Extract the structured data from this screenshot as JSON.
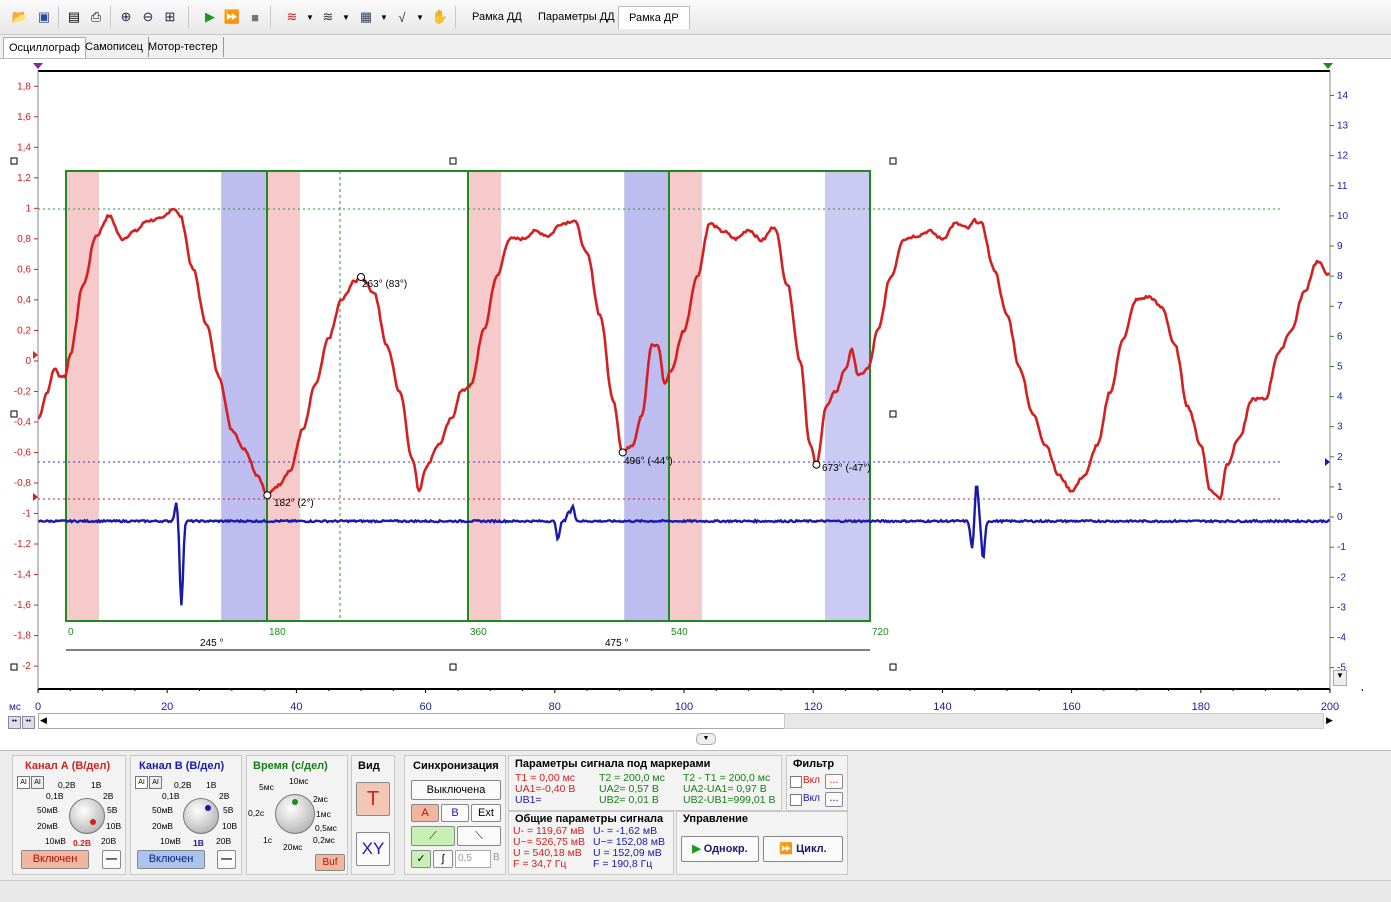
{
  "colors": {
    "channel_a": "#d42020",
    "channel_b": "#1a1aa8",
    "frame": "#1f8a1f",
    "zone_red": "#f3b8b8",
    "zone_blue": "#b8b8ee"
  },
  "toolbar": {
    "icons": [
      "open-icon",
      "save-icon",
      "print-preview-icon",
      "print-icon",
      "zoom-in-icon",
      "zoom-out-icon",
      "zoom-fit-icon",
      "start-icon",
      "fast-start-icon",
      "stop-icon",
      "signal-tool-icon",
      "signal-tool-2-icon",
      "calculator-icon",
      "math-function-icon",
      "settings-icon"
    ],
    "tabs": [
      "Рамка ДД",
      "Параметры ДД",
      "Рамка ДР"
    ],
    "active_tab": "Рамка ДР"
  },
  "mode_tabs": [
    "Осциллограф",
    "Самописец",
    "Мотор-тестер"
  ],
  "active_mode": "Осциллограф",
  "plot": {
    "x_unit": "мс",
    "x_ticks": [
      "0",
      "20",
      "40",
      "60",
      "80",
      "100",
      "120",
      "140",
      "160",
      "180",
      "200"
    ],
    "left_ticks": [
      "1,8",
      "1,6",
      "1,4",
      "1,2",
      "1",
      "0,8",
      "0,6",
      "0,4",
      "0,2",
      "0",
      "-0,2",
      "-0,4",
      "-0,6",
      "-0,8",
      "-1",
      "-1,2",
      "-1,4",
      "-1,6",
      "-1,8",
      "-2"
    ],
    "right_ticks": [
      "14",
      "13",
      "12",
      "11",
      "10",
      "9",
      "8",
      "7",
      "6",
      "5",
      "4",
      "3",
      "2",
      "1",
      "0",
      "-1",
      "-2",
      "-3",
      "-4",
      "-5"
    ],
    "degree_labels": [
      "0",
      "180",
      "360",
      "540",
      "720"
    ],
    "spans": [
      "245 °",
      "475 °"
    ],
    "annotations": [
      "263° (83°)",
      "182° (2°)",
      "496° (-44°)",
      "673° (-47°)"
    ]
  },
  "channel_a": {
    "title": "Канал А (В/дел)",
    "knob_labels": [
      "0,2В",
      "1В",
      "0,1В",
      "2В",
      "50мВ",
      "5В",
      "20мВ",
      "10В",
      "10мВ",
      "20В"
    ],
    "value": "0.2В",
    "enabled_label": "Включен",
    "minus": "—"
  },
  "channel_b": {
    "title": "Канал В (В/дел)",
    "knob_labels": [
      "0,2В",
      "1В",
      "0,1В",
      "2В",
      "50мВ",
      "5В",
      "20мВ",
      "10В",
      "10мВ",
      "20В"
    ],
    "value": "1В",
    "enabled_label": "Включен",
    "minus": "—"
  },
  "time": {
    "title": "Время (с/дел)",
    "knob_labels": [
      "10мс",
      "5мс",
      "2мс",
      "1мс",
      "0,2с",
      "0,5мс",
      "1с",
      "0,2мс",
      "20мс"
    ],
    "buf_label": "Buf"
  },
  "view": {
    "title": "Вид",
    "t_label": "T",
    "xy_label": "XY"
  },
  "sync": {
    "title": "Синхронизация",
    "mode": "Выключена",
    "channels": [
      "A",
      "B",
      "Ext"
    ],
    "level": "0,5",
    "unit": "В"
  },
  "marker_params": {
    "title": "Параметры сигнала под маркерами",
    "col1": [
      "T1 = 0,00 мс",
      "UA1=-0,40 В",
      "UB1="
    ],
    "col2": [
      "T2 = 200,0 мс",
      "UA2= 0,57 В",
      "UB2= 0,01 В"
    ],
    "col3": [
      "T2 - T1 = 200,0 мс",
      "UA2-UA1= 0,97 В",
      "UB2-UB1=999,01 В"
    ]
  },
  "common_params": {
    "title": "Общие параметры сигнала",
    "col_a": [
      "U- = 119,67 мВ",
      "U~= 526,75 мВ",
      "U = 540,18 мВ",
      "F = 34,7 Гц"
    ],
    "col_b": [
      "U- = -1,62 мВ",
      "U~= 152,08 мВ",
      "U = 152,09 мВ",
      "F = 190,8 Гц"
    ]
  },
  "filter": {
    "title": "Фильтр",
    "items": [
      "Вкл",
      "Вкл"
    ],
    "more": "..."
  },
  "control": {
    "title": "Управление",
    "single": "Однокр.",
    "cycle": "Цикл."
  }
}
